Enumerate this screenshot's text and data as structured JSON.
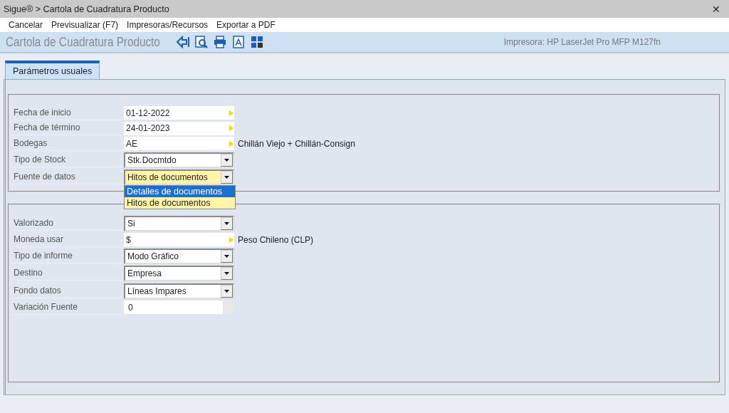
{
  "window": {
    "title": "Sigue® > Cartola de Cuadratura Producto",
    "close": "✕"
  },
  "menu": [
    "Cancelar",
    "Previsualizar (F7)",
    "Impresoras/Recursos",
    "Exportar a PDF"
  ],
  "toolbar": {
    "title": "Cartola de Cuadratura Producto",
    "printer": "Impresora: HP LaserJet Pro MFP M127fn"
  },
  "tabs": [
    {
      "label": "Parámetros usuales",
      "selected": true
    }
  ],
  "groups": [
    {
      "fields": [
        {
          "label": "Fecha de inicio",
          "kind": "lookup",
          "value": "01-12-2022",
          "focused": false
        },
        {
          "label": "Fecha de término",
          "kind": "lookup",
          "value": "24-01-2023",
          "focused": false
        },
        {
          "label": "Bodegas",
          "kind": "lookup",
          "value": "AE",
          "description": "Chillán Viejo + Chillán-Consign",
          "focused": false
        },
        {
          "label": "Tipo de Stock",
          "kind": "combo",
          "value": "Stk.Docmtdo",
          "focused": false
        },
        {
          "label": "Fuente de datos",
          "kind": "combo",
          "value": "Hitos de documentos",
          "focused": true,
          "options": [
            {
              "label": "Detalles de documentos",
              "highlighted": true
            },
            {
              "label": "Hitos de documentos",
              "highlighted": false
            }
          ]
        }
      ]
    },
    {
      "fields": [
        {
          "label": "Valorizado",
          "kind": "combo",
          "value": "Si",
          "focused": false
        },
        {
          "label": "Moneda usar",
          "kind": "lookup",
          "value": "$",
          "description": "Peso Chileno (CLP)",
          "focused": false
        },
        {
          "label": "Tipo de informe",
          "kind": "combo",
          "value": "Modo Gráfico",
          "focused": false
        },
        {
          "label": "Destino",
          "kind": "combo",
          "value": "Empresa",
          "focused": false
        },
        {
          "label": "Fondo datos",
          "kind": "combo",
          "value": "Líneas Impares",
          "focused": false
        },
        {
          "label": "Variación Fuente",
          "kind": "number",
          "value": "0",
          "focused": false
        }
      ]
    }
  ]
}
